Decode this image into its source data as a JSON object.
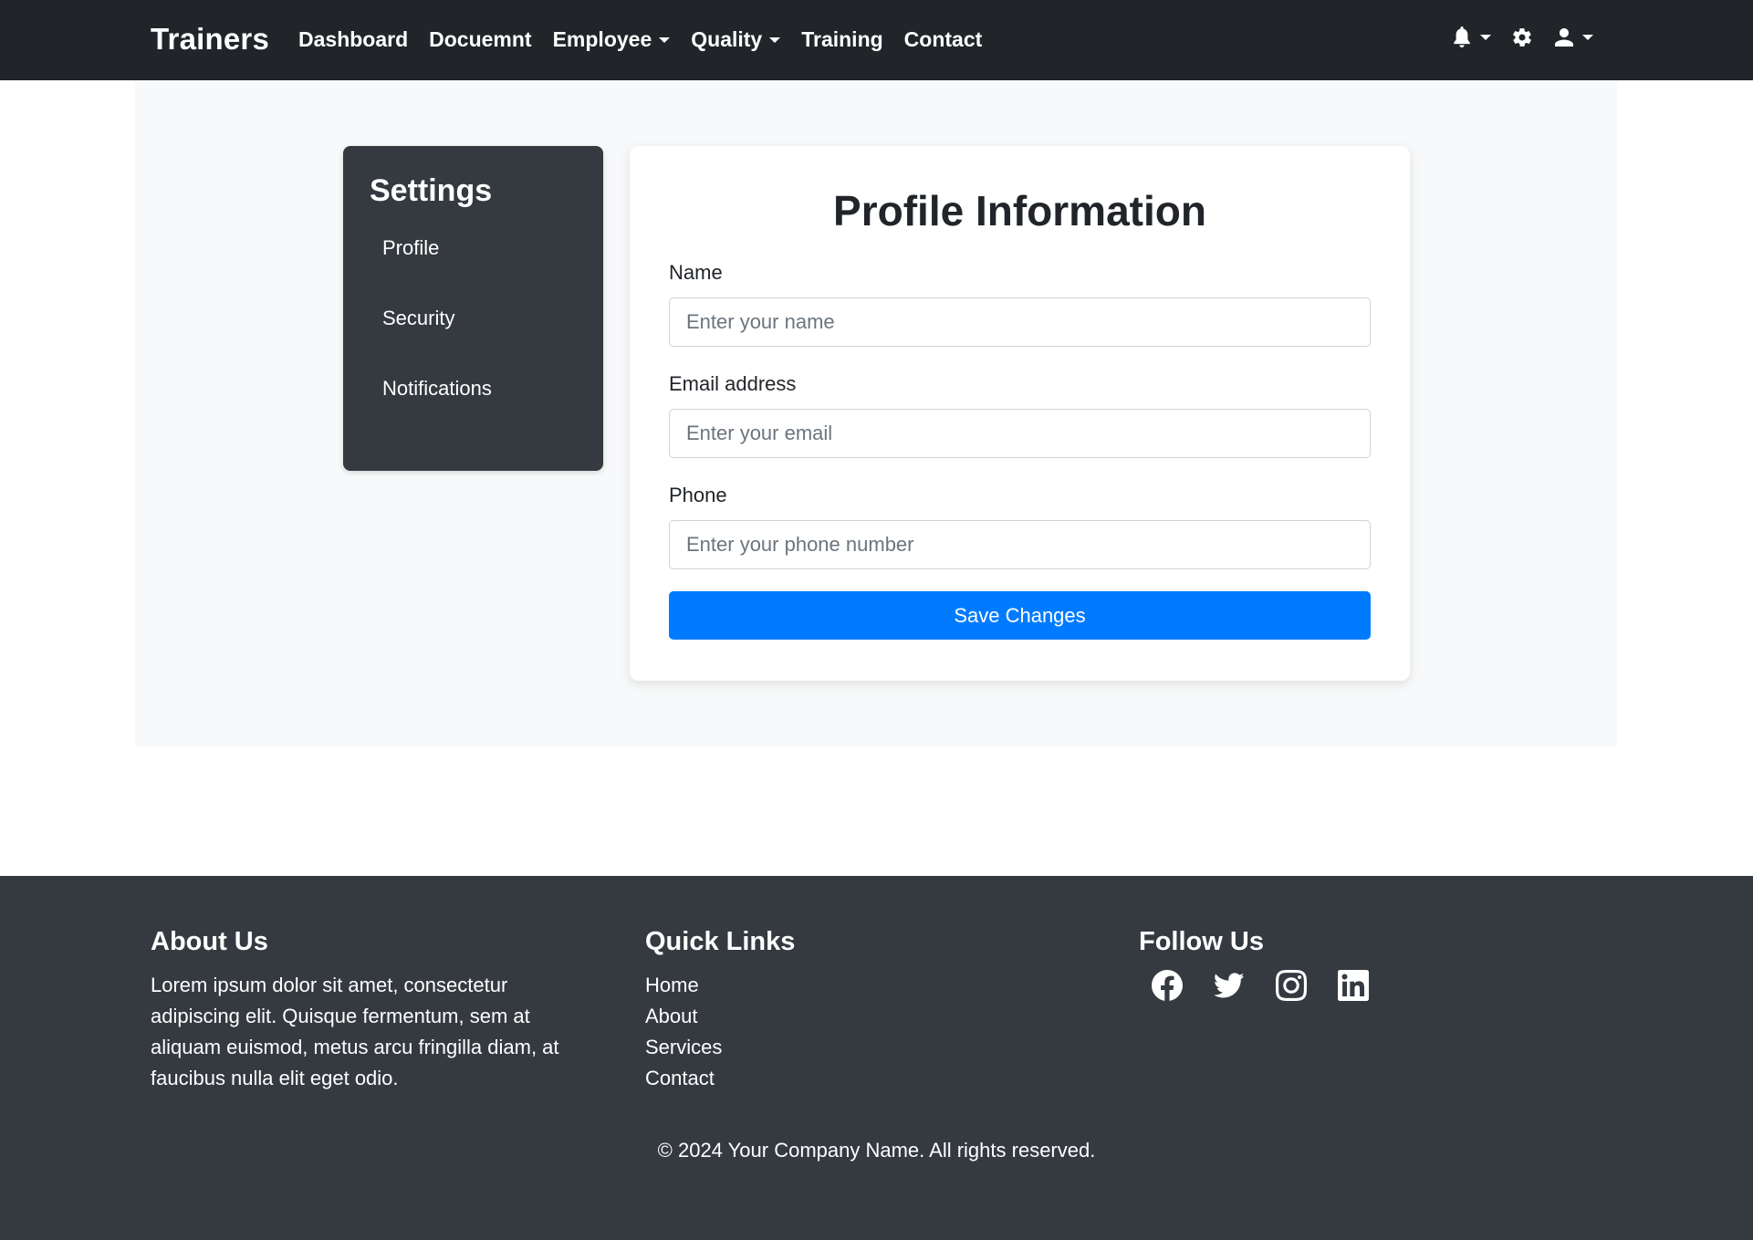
{
  "navbar": {
    "brand": "Trainers",
    "links": [
      {
        "label": "Dashboard",
        "dropdown": false
      },
      {
        "label": "Docuemnt",
        "dropdown": false
      },
      {
        "label": "Employee",
        "dropdown": true
      },
      {
        "label": "Quality",
        "dropdown": true
      },
      {
        "label": "Training",
        "dropdown": false
      },
      {
        "label": "Contact",
        "dropdown": false
      }
    ],
    "icons": [
      "bell-icon",
      "gear-icon",
      "user-icon"
    ]
  },
  "sidebar": {
    "title": "Settings",
    "items": [
      {
        "label": "Profile"
      },
      {
        "label": "Security"
      },
      {
        "label": "Notifications"
      }
    ]
  },
  "profile": {
    "title": "Profile Information",
    "fields": [
      {
        "label": "Name",
        "placeholder": "Enter your name",
        "value": ""
      },
      {
        "label": "Email address",
        "placeholder": "Enter your email",
        "value": ""
      },
      {
        "label": "Phone",
        "placeholder": "Enter your phone number",
        "value": ""
      }
    ],
    "save_label": "Save Changes"
  },
  "footer": {
    "about": {
      "heading": "About Us",
      "text": "Lorem ipsum dolor sit amet, consectetur adipiscing elit. Quisque fermentum, sem at aliquam euismod, metus arcu fringilla diam, at faucibus nulla elit eget odio."
    },
    "quick_links": {
      "heading": "Quick Links",
      "items": [
        "Home",
        "About",
        "Services",
        "Contact"
      ]
    },
    "follow": {
      "heading": "Follow Us",
      "icons": [
        "facebook-icon",
        "twitter-icon",
        "instagram-icon",
        "linkedin-icon"
      ]
    },
    "copyright": "© 2024 Your Company Name. All rights reserved."
  },
  "colors": {
    "navbar_bg": "#212529",
    "sidebar_bg": "#343a40",
    "footer_bg": "#343a40",
    "primary": "#007bff",
    "page_bg": "#f8f9fa"
  }
}
